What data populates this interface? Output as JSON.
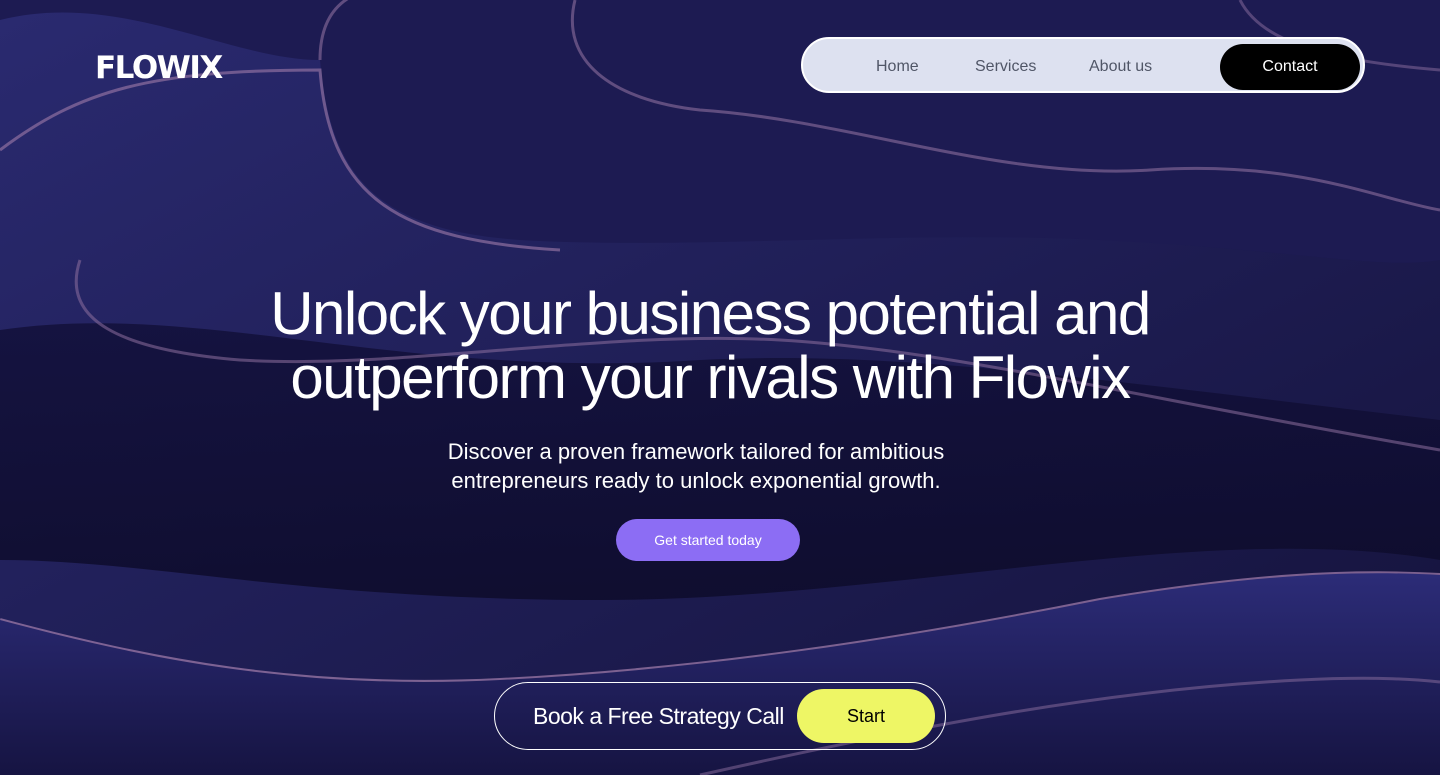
{
  "brand": {
    "logo": "FLOWIX"
  },
  "nav": {
    "items": [
      "Home",
      "Services",
      "About us"
    ],
    "contact_label": "Contact"
  },
  "hero": {
    "headline_line1": "Unlock your business potential and",
    "headline_line2": "outperform your rivals with Flowix",
    "subtitle_line1": "Discover a proven framework tailored for ambitious",
    "subtitle_line2": "entrepreneurs ready to unlock exponential growth.",
    "cta_label": "Get started today"
  },
  "booking": {
    "label": "Book a Free Strategy Call",
    "start_label": "Start"
  },
  "colors": {
    "background": "#1a1747",
    "wave_highlight": "#8e6f9f",
    "nav_bg": "#dde1f0",
    "cta": "#8c6df4",
    "start_button": "#eef665"
  }
}
